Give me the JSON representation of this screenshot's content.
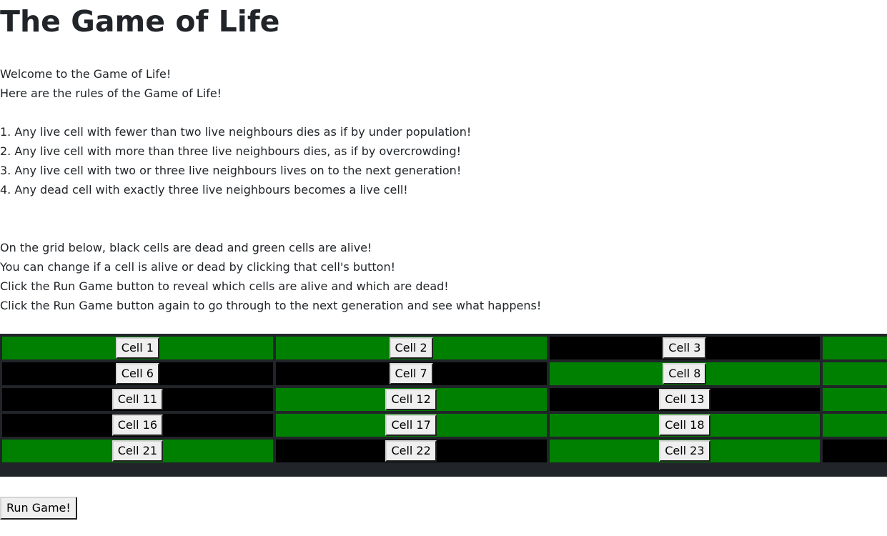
{
  "page": {
    "title": "The Game of Life",
    "intro": [
      "Welcome to the Game of Life!",
      "Here are the rules of the Game of Life!"
    ],
    "rules": [
      "1. Any live cell with fewer than two live neighbours dies as if by under population!",
      "2. Any live cell with more than three live neighbours dies, as if by overcrowding!",
      "3. Any live cell with two or three live neighbours lives on to the next generation!",
      "4. Any dead cell with exactly three live neighbours becomes a live cell!"
    ],
    "instructions": [
      "On the grid below, black cells are dead and green cells are alive!",
      "You can change if a cell is alive or dead by clicking that cell's button!",
      "Click the Run Game button to reveal which cells are alive and which are dead!",
      "Click the Run Game button again to go through to the next generation and see what happens!"
    ]
  },
  "grid": {
    "colors": {
      "alive": "#008000",
      "dead": "#000000",
      "border": "#212529"
    },
    "rows": [
      [
        {
          "label": "Cell 1",
          "state": "alive"
        },
        {
          "label": "Cell 2",
          "state": "alive"
        },
        {
          "label": "Cell 3",
          "state": "dead"
        },
        {
          "label": "",
          "state": "alive"
        }
      ],
      [
        {
          "label": "Cell 6",
          "state": "dead"
        },
        {
          "label": "Cell 7",
          "state": "dead"
        },
        {
          "label": "Cell 8",
          "state": "alive"
        },
        {
          "label": "",
          "state": "alive"
        }
      ],
      [
        {
          "label": "Cell 11",
          "state": "dead"
        },
        {
          "label": "Cell 12",
          "state": "alive"
        },
        {
          "label": "Cell 13",
          "state": "dead"
        },
        {
          "label": "",
          "state": "alive"
        }
      ],
      [
        {
          "label": "Cell 16",
          "state": "dead"
        },
        {
          "label": "Cell 17",
          "state": "alive"
        },
        {
          "label": "Cell 18",
          "state": "alive"
        },
        {
          "label": "",
          "state": "alive"
        }
      ],
      [
        {
          "label": "Cell 21",
          "state": "alive"
        },
        {
          "label": "Cell 22",
          "state": "dead"
        },
        {
          "label": "Cell 23",
          "state": "alive"
        },
        {
          "label": "",
          "state": "dead"
        }
      ]
    ]
  },
  "controls": {
    "run_label": "Run Game!"
  }
}
